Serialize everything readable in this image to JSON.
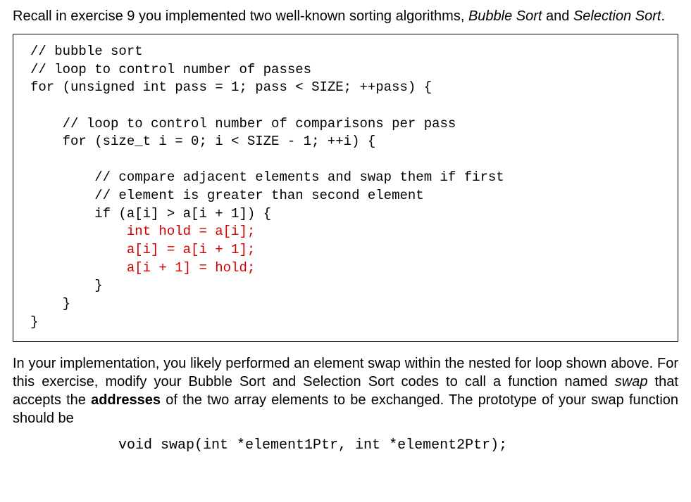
{
  "intro": {
    "t1": "Recall in exercise 9 you implemented two well-known sorting algorithms, ",
    "bubble": "Bubble Sort",
    "t2": " and ",
    "selection": "Selection Sort",
    "t3": "."
  },
  "code": {
    "l01": "// bubble sort",
    "l02": "// loop to control number of passes",
    "l03": "for (unsigned int pass = 1; pass < SIZE; ++pass) {",
    "l04": "",
    "l05": "    // loop to control number of comparisons per pass",
    "l06": "    for (size_t i = 0; i < SIZE - 1; ++i) {",
    "l07": "",
    "l08": "        // compare adjacent elements and swap them if first",
    "l09": "        // element is greater than second element",
    "l10": "        if (a[i] > a[i + 1]) {",
    "l11": "            int hold = a[i];",
    "l12": "            a[i] = a[i + 1];",
    "l13": "            a[i + 1] = hold;",
    "l14": "        }",
    "l15": "    }",
    "l16": "}"
  },
  "para2": {
    "t1": "In your implementation, you likely performed an element swap within the nested for loop shown above.  For this exercise, modify your Bubble Sort and Selection Sort codes to call a function named ",
    "swap": "swap",
    "t2": " that accepts the ",
    "addresses": "addresses",
    "t3": " of the two array elements to be exchanged.  The prototype of your swap function should be"
  },
  "prototype": "void swap(int *element1Ptr, int *element2Ptr);"
}
